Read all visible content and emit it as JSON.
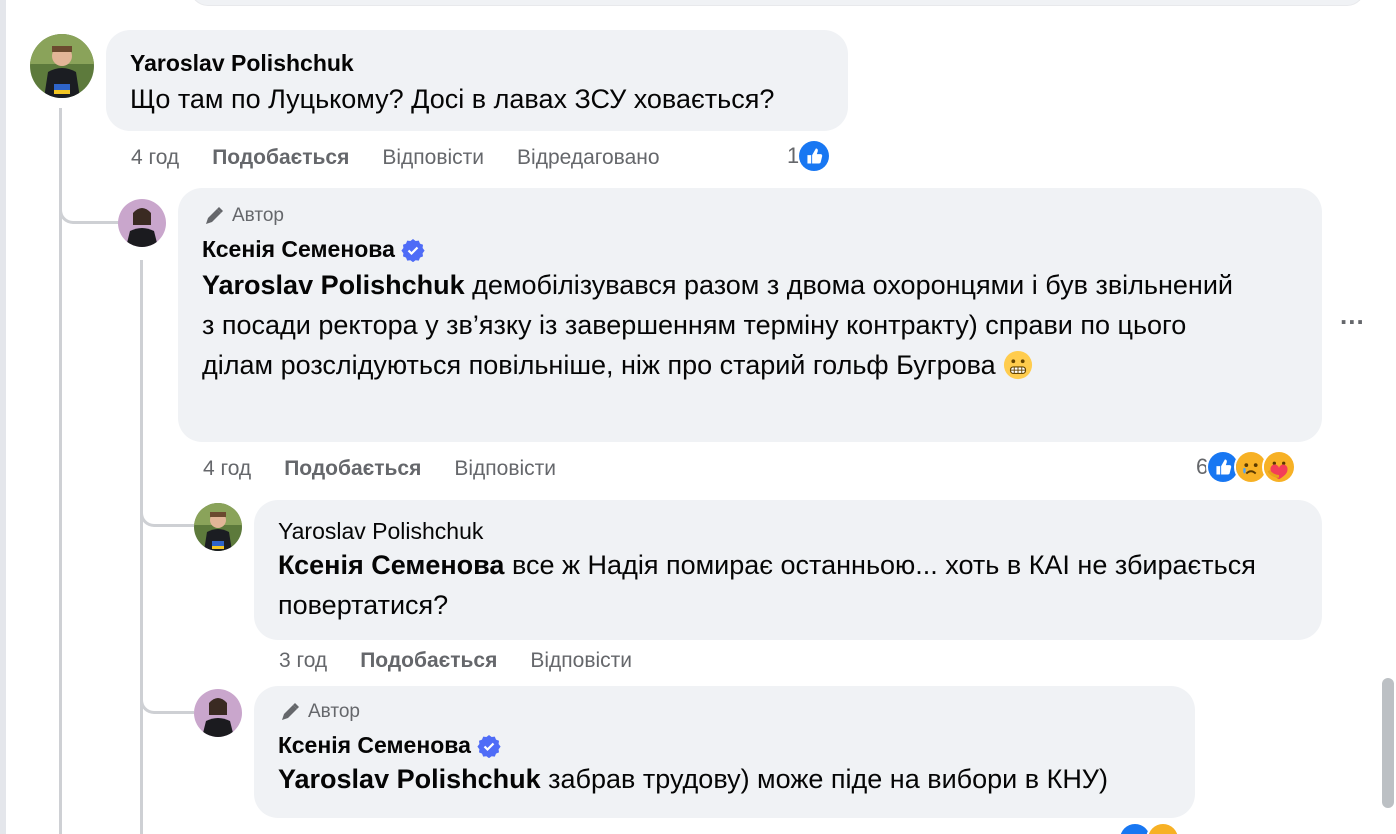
{
  "comments": [
    {
      "name": "Yaroslav Polishchuk",
      "text": "Що там по Луцькому? Досі в лавах ЗСУ ховається?",
      "time": "4 год",
      "like": "Подобається",
      "reply": "Відповісти",
      "edited": "Відредаговано",
      "reaction_count": "1"
    },
    {
      "badge": "Автор",
      "name": "Ксенія Семенова",
      "mention": "Yaroslav Polishchuk",
      "text": " демобілізувався разом з двома охоронцями і був звільнений з посади ректора у зв’язку із завершенням терміну контракту) справи по цього ділам розслідуються повільніше, ніж про старий гольф Бугрова",
      "time": "4 год",
      "like": "Подобається",
      "reply": "Відповісти",
      "reaction_count": "6"
    },
    {
      "name": "Yaroslav Polishchuk",
      "mention": "Ксенія Семенова",
      "text": " все ж Надія помирає останньою... хоть в КАІ не збирається повертатися?",
      "time": "3 год",
      "like": "Подобається",
      "reply": "Відповісти"
    },
    {
      "badge": "Автор",
      "name": "Ксенія Семенова",
      "mention": "Yaroslav Polishchuk",
      "text": " забрав трудову) може піде на вибори в КНУ)"
    }
  ],
  "more_menu": "...",
  "icons": {
    "author": "microphone-pencil-icon",
    "verified": "verified-badge-icon",
    "like": "like-reaction-icon",
    "sad": "sad-reaction-icon",
    "care": "care-reaction-icon",
    "grimace": "grimacing-emoji"
  },
  "colors": {
    "bubble": "#f0f2f5",
    "secondary_text": "#65676b",
    "like_blue": "#1877f2",
    "verified_blue": "#4f6cf7"
  }
}
